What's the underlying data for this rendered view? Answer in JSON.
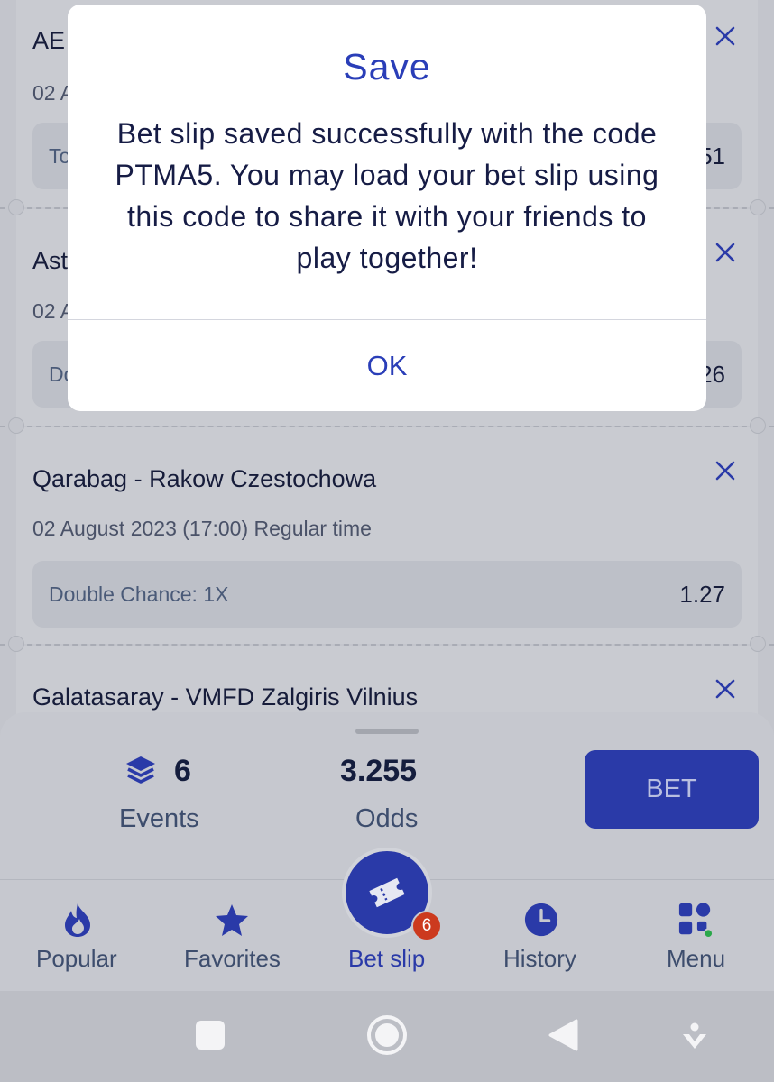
{
  "matches": [
    {
      "title": "AE",
      "date": "02 A",
      "market": "To",
      "odd": "51"
    },
    {
      "title": "Ast",
      "date": "02 A",
      "market": "Do",
      "odd": "26"
    },
    {
      "title": "Qarabag - Rakow Czestochowa",
      "date": "02 August 2023 (17:00) Regular time",
      "market": "Double Chance: 1X",
      "odd": "1.27"
    },
    {
      "title": "Galatasaray - VMFD Zalgiris Vilnius"
    }
  ],
  "dialog": {
    "title": "Save",
    "message": "Bet slip saved successfully with the code PTMA5. You may load your bet slip using this code to share it with your friends to play together!",
    "ok_label": "OK"
  },
  "summary": {
    "events_count": "6",
    "events_label": "Events",
    "odds_value": "3.255",
    "odds_label": "Odds",
    "bet_label": "BET"
  },
  "nav": {
    "items": [
      {
        "label": "Popular",
        "icon": "flame-icon"
      },
      {
        "label": "Favorites",
        "icon": "star-icon"
      },
      {
        "label": "Bet slip",
        "icon": "ticket-icon",
        "badge": "6",
        "active": true
      },
      {
        "label": "History",
        "icon": "clock-icon"
      },
      {
        "label": "Menu",
        "icon": "grid-icon"
      }
    ]
  },
  "colors": {
    "accent": "#2a3aa8",
    "dialog_accent": "#2a3eb8",
    "badge": "#cc3a1e",
    "dim_background": "#c3c5cc"
  }
}
